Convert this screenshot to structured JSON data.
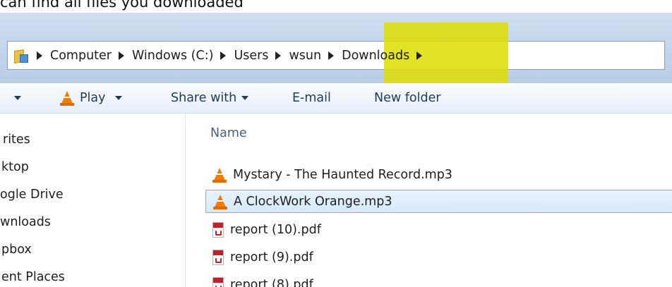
{
  "caption": "can find all files you downloaded",
  "breadcrumb": [
    "Computer",
    "Windows (C:)",
    "Users",
    "wsun",
    "Downloads"
  ],
  "toolbar": {
    "play": "Play",
    "share_with": "Share with",
    "email": "E-mail",
    "new_folder": "New folder"
  },
  "nav": [
    "rites",
    "ktop",
    "ogle Drive",
    "wnloads",
    "pbox",
    "ent Places"
  ],
  "files": {
    "column_name": "Name",
    "items": [
      {
        "name": "Mystary - The Haunted Record.mp3",
        "icon": "vlc-cone-icon"
      },
      {
        "name": "A ClockWork Orange.mp3",
        "icon": "vlc-cone-icon",
        "selected": true
      },
      {
        "name": "report (10).pdf",
        "icon": "pdf-icon"
      },
      {
        "name": "report (9).pdf",
        "icon": "pdf-icon"
      },
      {
        "name": "report (8).pdf",
        "icon": "pdf-icon"
      }
    ]
  },
  "colors": {
    "highlight": "#dede00",
    "selection": "#d6e9fb",
    "vlc_orange": "#f07c00"
  }
}
